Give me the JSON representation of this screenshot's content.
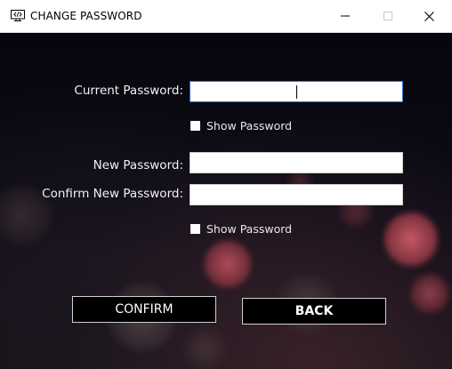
{
  "window": {
    "title": "CHANGE PASSWORD",
    "icons": {
      "app": "monitor-code-icon",
      "minimize": "minimize-icon",
      "maximize": "maximize-icon",
      "close": "close-icon"
    }
  },
  "form": {
    "current_password": {
      "label": "Current Password:",
      "value": ""
    },
    "show_password_1": {
      "label": "Show Password",
      "checked": false
    },
    "new_password": {
      "label": "New Password:",
      "value": ""
    },
    "confirm_new_password": {
      "label": "Confirm New Password:",
      "value": ""
    },
    "show_password_2": {
      "label": "Show Password",
      "checked": false
    }
  },
  "buttons": {
    "confirm": "CONFIRM",
    "back": "BACK"
  },
  "colors": {
    "titlebar": "#ffffff",
    "background": "#0a0a12",
    "bokeh": "#e0606e",
    "focus_border": "#2b7bd6",
    "button_bg": "#000000",
    "button_text": "#ffffff"
  }
}
